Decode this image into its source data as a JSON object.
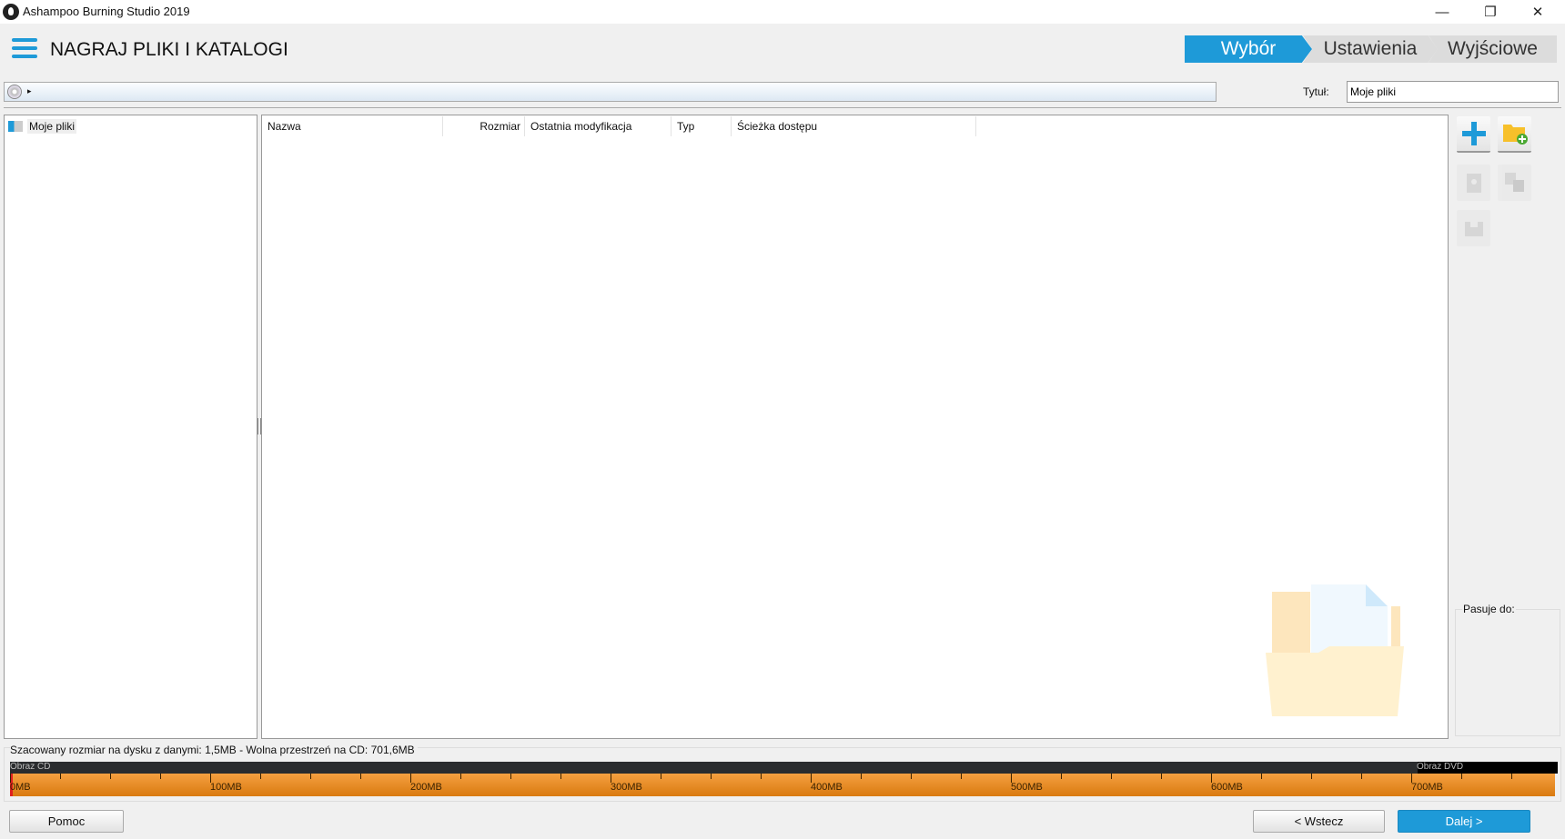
{
  "window": {
    "title": "Ashampoo Burning Studio 2019",
    "minimize": "—",
    "restore": "❐",
    "close": "✕"
  },
  "header": {
    "title": "NAGRAJ PLIKI I KATALOGI",
    "steps": [
      {
        "label": "Wybór",
        "active": true
      },
      {
        "label": "Ustawienia",
        "active": false
      },
      {
        "label": "Wyjściowe",
        "active": false
      }
    ]
  },
  "path": {
    "arrow": "▸"
  },
  "disc_title": {
    "label": "Tytuł:",
    "value": "Moje pliki"
  },
  "tree": {
    "items": [
      {
        "label": "Moje pliki"
      }
    ]
  },
  "filelist": {
    "columns": [
      "Nazwa",
      "Rozmiar",
      "Ostatnia modyfikacja",
      "Typ",
      "Ścieżka dostępu"
    ],
    "rows": []
  },
  "tools": {
    "add_files": "add",
    "new_folder": "new-folder",
    "delete": "delete",
    "rename": "rename",
    "save": "save"
  },
  "fits": {
    "label": "Pasuje do:"
  },
  "capacity": {
    "text": "Szacowany rozmiar na dysku z danymi: 1,5MB - Wolna przestrzeń na CD: 701,6MB",
    "used_mb": 1.5,
    "cd_label": "Obraz CD",
    "dvd_label": "Obraz DVD",
    "dvd_start_mb": 703,
    "tick_labels": [
      "0MB",
      "100MB",
      "200MB",
      "300MB",
      "400MB",
      "500MB",
      "600MB",
      "700MB"
    ],
    "accent": "#e8901e"
  },
  "buttons": {
    "help": "Pomoc",
    "back": "< Wstecz",
    "next": "Dalej >"
  },
  "colors": {
    "accent": "#1e9ad8"
  }
}
